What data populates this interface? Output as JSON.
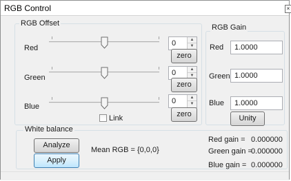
{
  "window": {
    "title": "RGB Control"
  },
  "rgb_offset": {
    "group_label": "RGB Offset",
    "channels": [
      {
        "label": "Red",
        "value": "0",
        "zero_label": "zero"
      },
      {
        "label": "Green",
        "value": "0",
        "zero_label": "zero"
      },
      {
        "label": "Blue",
        "value": "0",
        "zero_label": "zero"
      }
    ],
    "link_label": "Link"
  },
  "rgb_gain": {
    "group_label": "RGB Gain",
    "channels": [
      {
        "label": "Red",
        "value": "1.0000"
      },
      {
        "label": "Green",
        "value": "1.0000"
      },
      {
        "label": "Blue",
        "value": "1.0000"
      }
    ],
    "unity_label": "Unity"
  },
  "white_balance": {
    "group_label": "White balance",
    "analyze_label": "Analyze",
    "apply_label": "Apply",
    "mean_rgb": "Mean RGB = {0,0,0}",
    "gains": [
      {
        "label": "Red gain =",
        "value": "0.000000"
      },
      {
        "label": "Green gain =",
        "value": "0.000000"
      },
      {
        "label": "Blue gain =",
        "value": "0.000000"
      }
    ]
  }
}
